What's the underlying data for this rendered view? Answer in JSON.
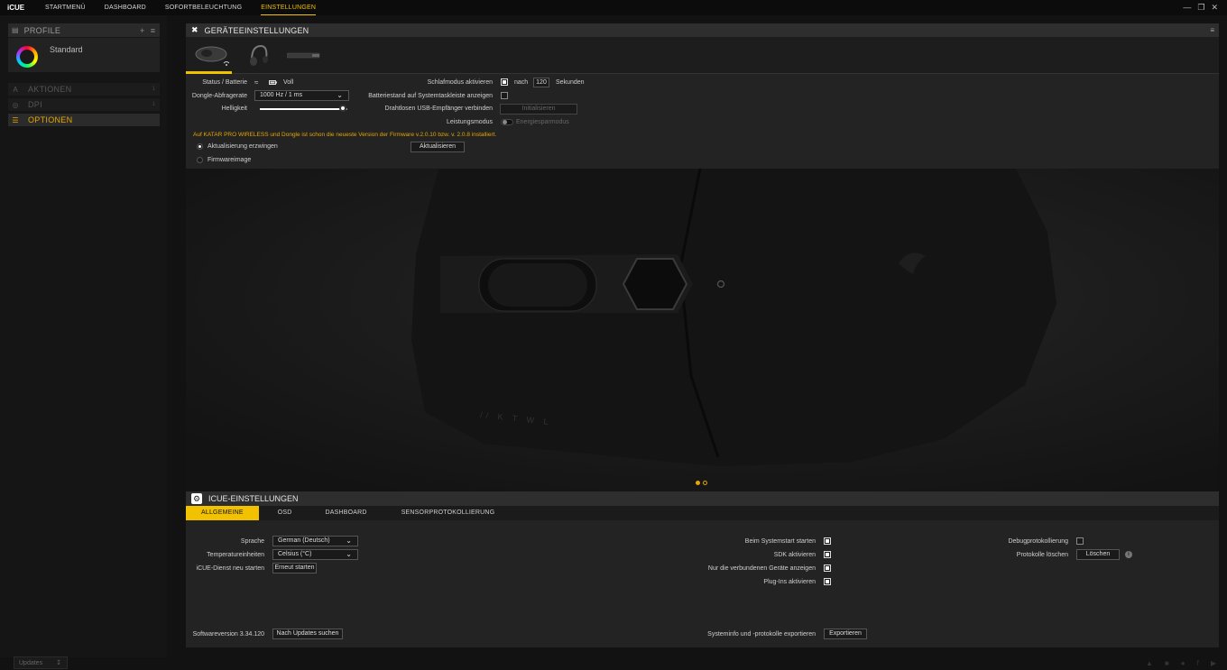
{
  "topbar": {
    "logo": "iCUE",
    "nav": [
      "STARTMENÜ",
      "DASHBOARD",
      "SOFORTBELEUCHTUNG",
      "EINSTELLUNGEN"
    ],
    "active": "EINSTELLUNGEN"
  },
  "sidebar": {
    "profile_header": "PROFILE",
    "profile_name": "Standard",
    "items": [
      {
        "label": "AKTIONEN",
        "count": "1"
      },
      {
        "label": "DPI",
        "count": "1"
      },
      {
        "label": "OPTIONEN",
        "count": ""
      }
    ],
    "updates_label": "Updates"
  },
  "device_panel": {
    "title": "GERÄTEEINSTELLUNGEN",
    "status_label": "Status / Batterie",
    "battery_value": "Voll",
    "dongle_label": "Dongle-Abfragerate",
    "dongle_value": "1000 Hz / 1 ms",
    "brightness_label": "Helligkeit",
    "brightness_level": 0.95,
    "sleep_label": "Schlafmodus aktivieren",
    "sleep_after": "nach",
    "sleep_seconds": "120",
    "sleep_unit": "Sekunden",
    "battery_tray_label": "Batteriestand auf Systemtaskleiste anzeigen",
    "usb_label": "Drahtlosen USB-Empfänger verbinden",
    "usb_button": "Initialisieren",
    "perf_label": "Leistungsmodus",
    "perf_value": "Energiesparmodus",
    "firmware_msg": "Auf KATAR PRO WIRELESS und Dongle ist schon die neueste Version der Firmware v.2.0.10 bzw. v. 2.0.8 installiert.",
    "force_update_label": "Aktualisierung erzwingen",
    "update_button": "Aktualisieren",
    "firmware_image_label": "Firmwareimage"
  },
  "hero": {
    "device_text": "// K T W L"
  },
  "icue_panel": {
    "title": "ICUE-EINSTELLUNGEN",
    "tabs": [
      "ALLGEMEINE",
      "OSD",
      "DASHBOARD",
      "SENSORPROTOKOLLIERUNG"
    ],
    "active_tab": "ALLGEMEINE",
    "language_label": "Sprache",
    "language_value": "German (Deutsch)",
    "temp_label": "Temperatureinheiten",
    "temp_value": "Celsius (°C)",
    "restart_label": "iCUE-Dienst neu starten",
    "restart_button": "Erneut starten",
    "startup_label": "Beim Systemstart starten",
    "sdk_label": "SDK aktivieren",
    "connected_label": "Nur die verbundenen Geräte anzeigen",
    "plugins_label": "Plug-Ins aktivieren",
    "debug_label": "Debugprotokollierung",
    "logs_label": "Protokolle löschen",
    "logs_button": "Löschen",
    "version_label": "Softwareversion 3.34.120",
    "check_updates_button": "Nach Updates suchen",
    "export_label": "Systeminfo und -protokolle exportieren",
    "export_button": "Exportieren"
  },
  "colors": {
    "accent": "#f2c200",
    "warning": "#e6a600"
  }
}
